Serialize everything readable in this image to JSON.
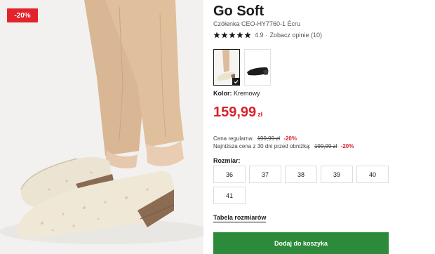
{
  "gallery": {
    "badge": "-20%",
    "image_alt": "product-photo"
  },
  "product": {
    "brand": "Go Soft",
    "model": "Czółenka CEO-HY7760-1 Écru",
    "rating": {
      "stars": 5,
      "value": "4.9",
      "separator": "·",
      "reviews_link": "Zobacz opinie (10)"
    },
    "colors": [
      {
        "name": "Kremowy",
        "selected": true
      },
      {
        "name": "Czarny",
        "selected": false
      }
    ],
    "color_label": "Kolor:",
    "color_value": "Kremowy",
    "price": {
      "value": "159,99",
      "currency": "zł"
    },
    "regular": {
      "label": "Cena regularna:",
      "old": "199,99 zł",
      "discount": "-20%"
    },
    "lowest": {
      "label": "Najniższa cena z 30 dni przed obniżką:",
      "old": "199,99 zł",
      "discount": "-20%"
    },
    "sizes_label": "Rozmiar:",
    "sizes": [
      "36",
      "37",
      "38",
      "39",
      "40",
      "41"
    ],
    "size_table_link": "Tabela rozmiarów",
    "add_to_cart": "Dodaj do koszyka"
  },
  "colors_theme": {
    "accent_red": "#d8232a",
    "cta_green": "#2d8a3a"
  }
}
